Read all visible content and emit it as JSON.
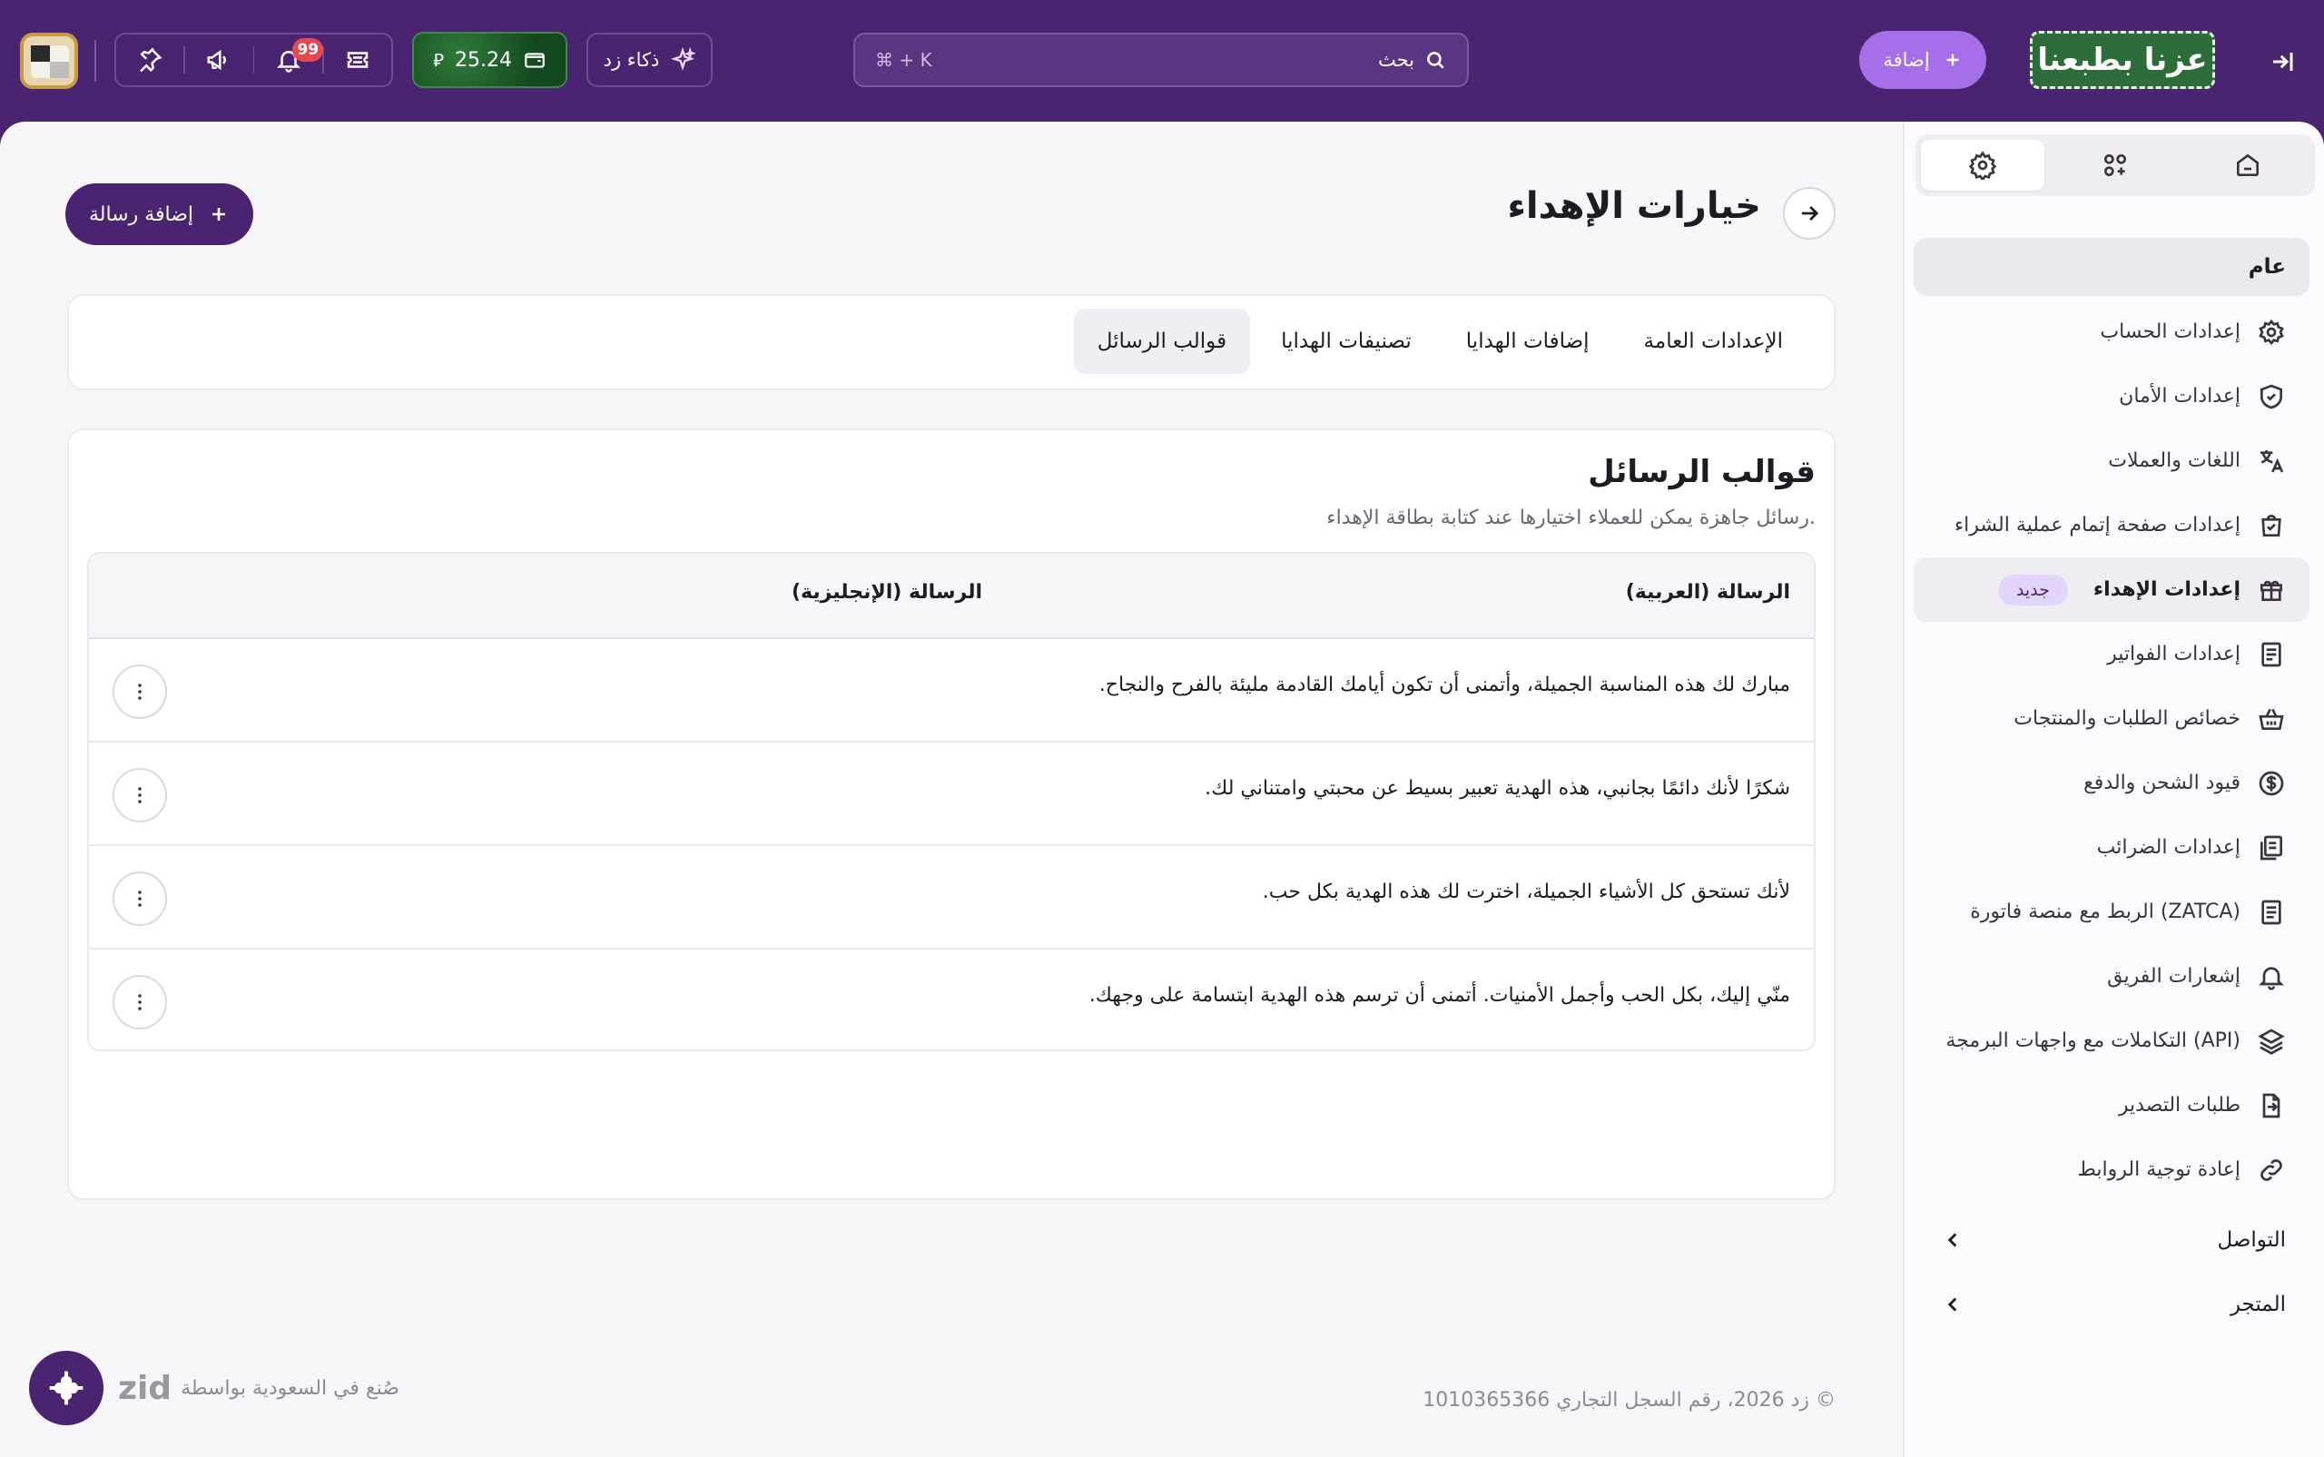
{
  "topbar": {
    "notifications_count": "99",
    "wallet_amount": "25.24",
    "currency_symbol": "⃁",
    "ai_label": "ذكاء زد",
    "search_placeholder": "بحث",
    "search_shortcut": "⌘ + K",
    "add_label": "إضافة",
    "brand_text": "عزنا بطبعنا"
  },
  "page": {
    "title": "خيارات الإهداء",
    "add_message_label": "إضافة رسالة",
    "tabs": [
      {
        "label": "الإعدادات العامة"
      },
      {
        "label": "إضافات الهدايا"
      },
      {
        "label": "تصنيفات الهدايا"
      },
      {
        "label": "قوالب الرسائل"
      }
    ],
    "active_tab": "قوالب الرسائل"
  },
  "templates": {
    "title": "قوالب الرسائل",
    "subtitle": "رسائل جاهزة يمكن للعملاء اختيارها عند كتابة بطاقة الإهداء.",
    "col_arabic": "الرسالة (العربية)",
    "col_english": "الرسالة (الإنجليزية)",
    "rows": [
      {
        "ar": "مبارك لك هذه المناسبة الجميلة، وأتمنى أن تكون أيامك القادمة مليئة بالفرح والنجاح.",
        "en": ""
      },
      {
        "ar": "شكرًا لأنك دائمًا بجانبي، هذه الهدية تعبير بسيط عن محبتي وامتناني لك.",
        "en": ""
      },
      {
        "ar": "لأنك تستحق كل الأشياء الجميلة، اخترت لك هذه الهدية بكل حب.",
        "en": ""
      },
      {
        "ar": "منّي إليك، بكل الحب وأجمل الأمنيات. أتمنى أن ترسم هذه الهدية ابتسامة على وجهك.",
        "en": ""
      }
    ]
  },
  "footer": {
    "zid_word": "zid",
    "made_in": "صُنع في السعودية بواسطة",
    "copyright": "© زد 2026، رقم السجل التجاري 1010365366"
  },
  "sidebar": {
    "general_label": "عام",
    "items": [
      {
        "label": "إعدادات الحساب",
        "icon": "gear-icon"
      },
      {
        "label": "إعدادات الأمان",
        "icon": "shield-check-icon"
      },
      {
        "label": "اللغات والعملات",
        "icon": "translate-icon"
      },
      {
        "label": "إعدادات صفحة إتمام عملية الشراء",
        "icon": "shopping-bag-icon"
      },
      {
        "label": "إعدادات الإهداء",
        "icon": "gift-icon",
        "badge": "جديد",
        "active": true
      },
      {
        "label": "إعدادات الفواتير",
        "icon": "invoice-icon"
      },
      {
        "label": "خصائص الطلبات والمنتجات",
        "icon": "basket-icon"
      },
      {
        "label": "قيود الشحن والدفع",
        "icon": "dollar-circle-icon"
      },
      {
        "label": "إعدادات الضرائب",
        "icon": "tax-docs-icon"
      },
      {
        "label": "الربط مع منصة فاتورة (ZATCA)",
        "icon": "document-icon"
      },
      {
        "label": "إشعارات الفريق",
        "icon": "bell-icon"
      },
      {
        "label": "التكاملات مع واجهات البرمجة (API)",
        "icon": "layers-icon"
      },
      {
        "label": "طلبات التصدير",
        "icon": "export-icon"
      },
      {
        "label": "إعادة توجية الروابط",
        "icon": "link-icon"
      }
    ],
    "groups": [
      {
        "label": "التواصل"
      },
      {
        "label": "المتجر"
      }
    ]
  },
  "colors": {
    "brand_purple": "#4a2470",
    "accent_purple": "#a66ee8",
    "badge_red": "#e5484d",
    "wallet_green": "#2f7a3a"
  }
}
